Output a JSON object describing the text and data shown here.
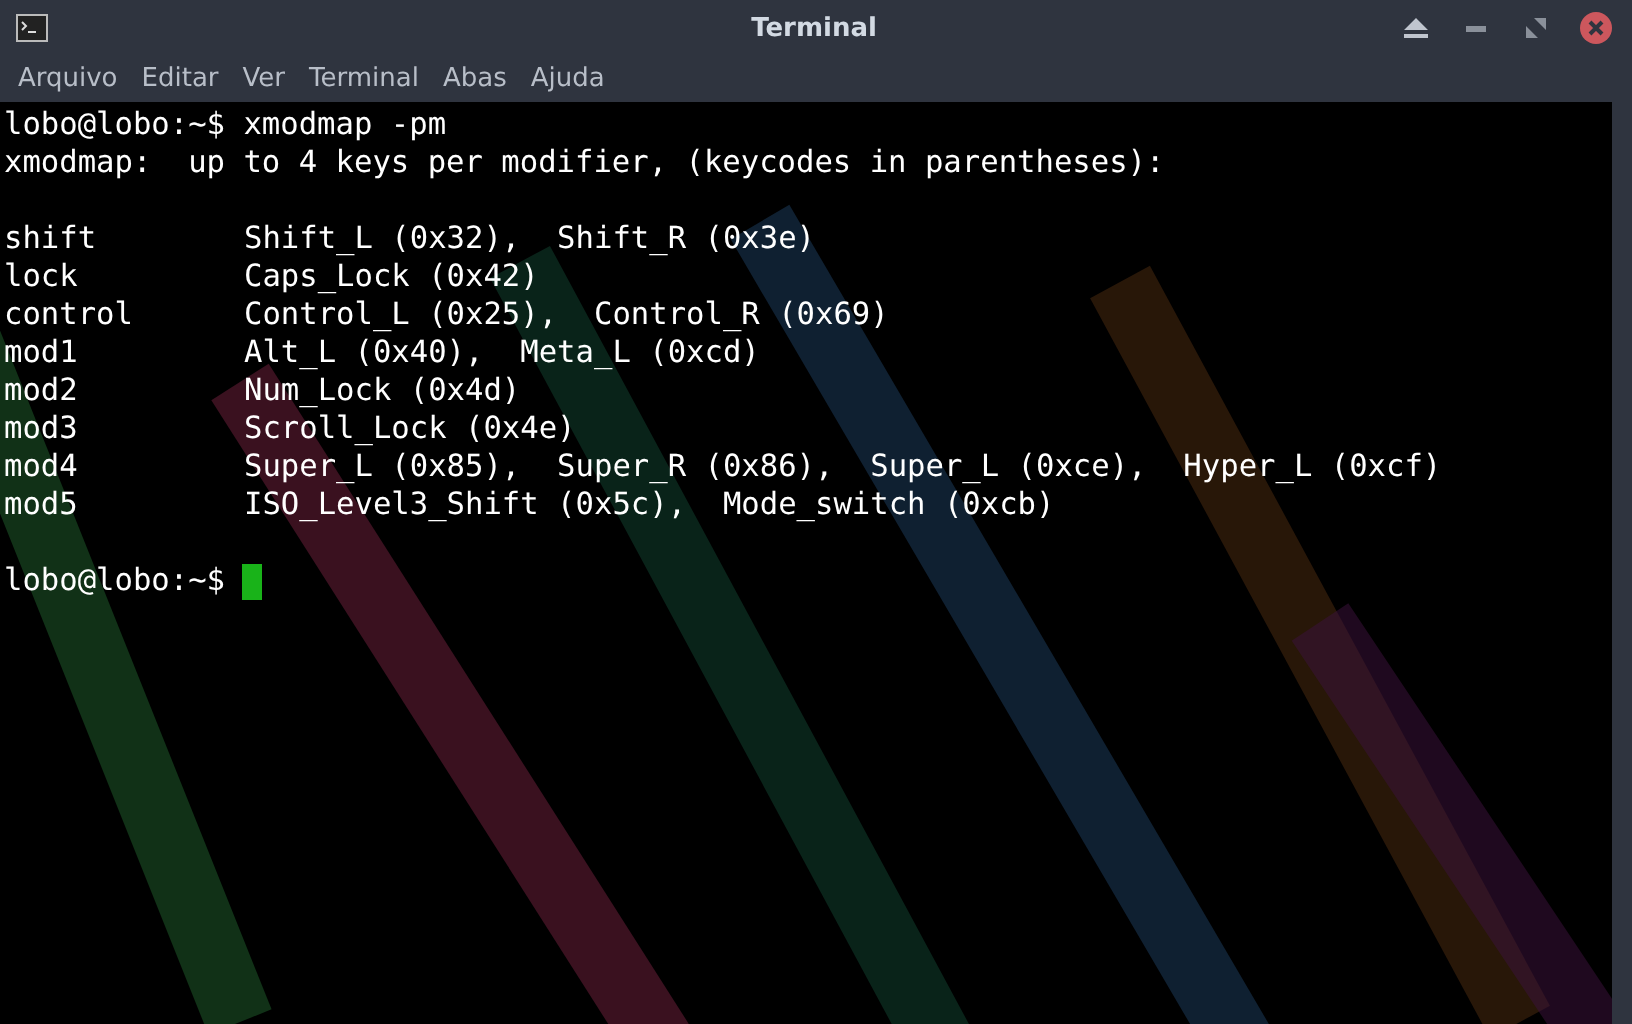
{
  "window": {
    "title": "Terminal"
  },
  "menu": [
    "Arquivo",
    "Editar",
    "Ver",
    "Terminal",
    "Abas",
    "Ajuda"
  ],
  "terminal": {
    "command_line": "lobo@lobo:~$ xmodmap -pm",
    "header": "xmodmap:  up to 4 keys per modifier, (keycodes in parentheses):",
    "rows": [
      {
        "modifier": "shift",
        "keys": "Shift_L (0x32),  Shift_R (0x3e)"
      },
      {
        "modifier": "lock",
        "keys": "Caps_Lock (0x42)"
      },
      {
        "modifier": "control",
        "keys": "Control_L (0x25),  Control_R (0x69)"
      },
      {
        "modifier": "mod1",
        "keys": "Alt_L (0x40),  Meta_L (0xcd)"
      },
      {
        "modifier": "mod2",
        "keys": "Num_Lock (0x4d)"
      },
      {
        "modifier": "mod3",
        "keys": "Scroll_Lock (0x4e)"
      },
      {
        "modifier": "mod4",
        "keys": "Super_L (0x85),  Super_R (0x86),  Super_L (0xce),  Hyper_L (0xcf)"
      },
      {
        "modifier": "mod5",
        "keys": "ISO_Level3_Shift (0x5c),  Mode_switch (0xcb)"
      }
    ],
    "prompt": "lobo@lobo:~$"
  }
}
